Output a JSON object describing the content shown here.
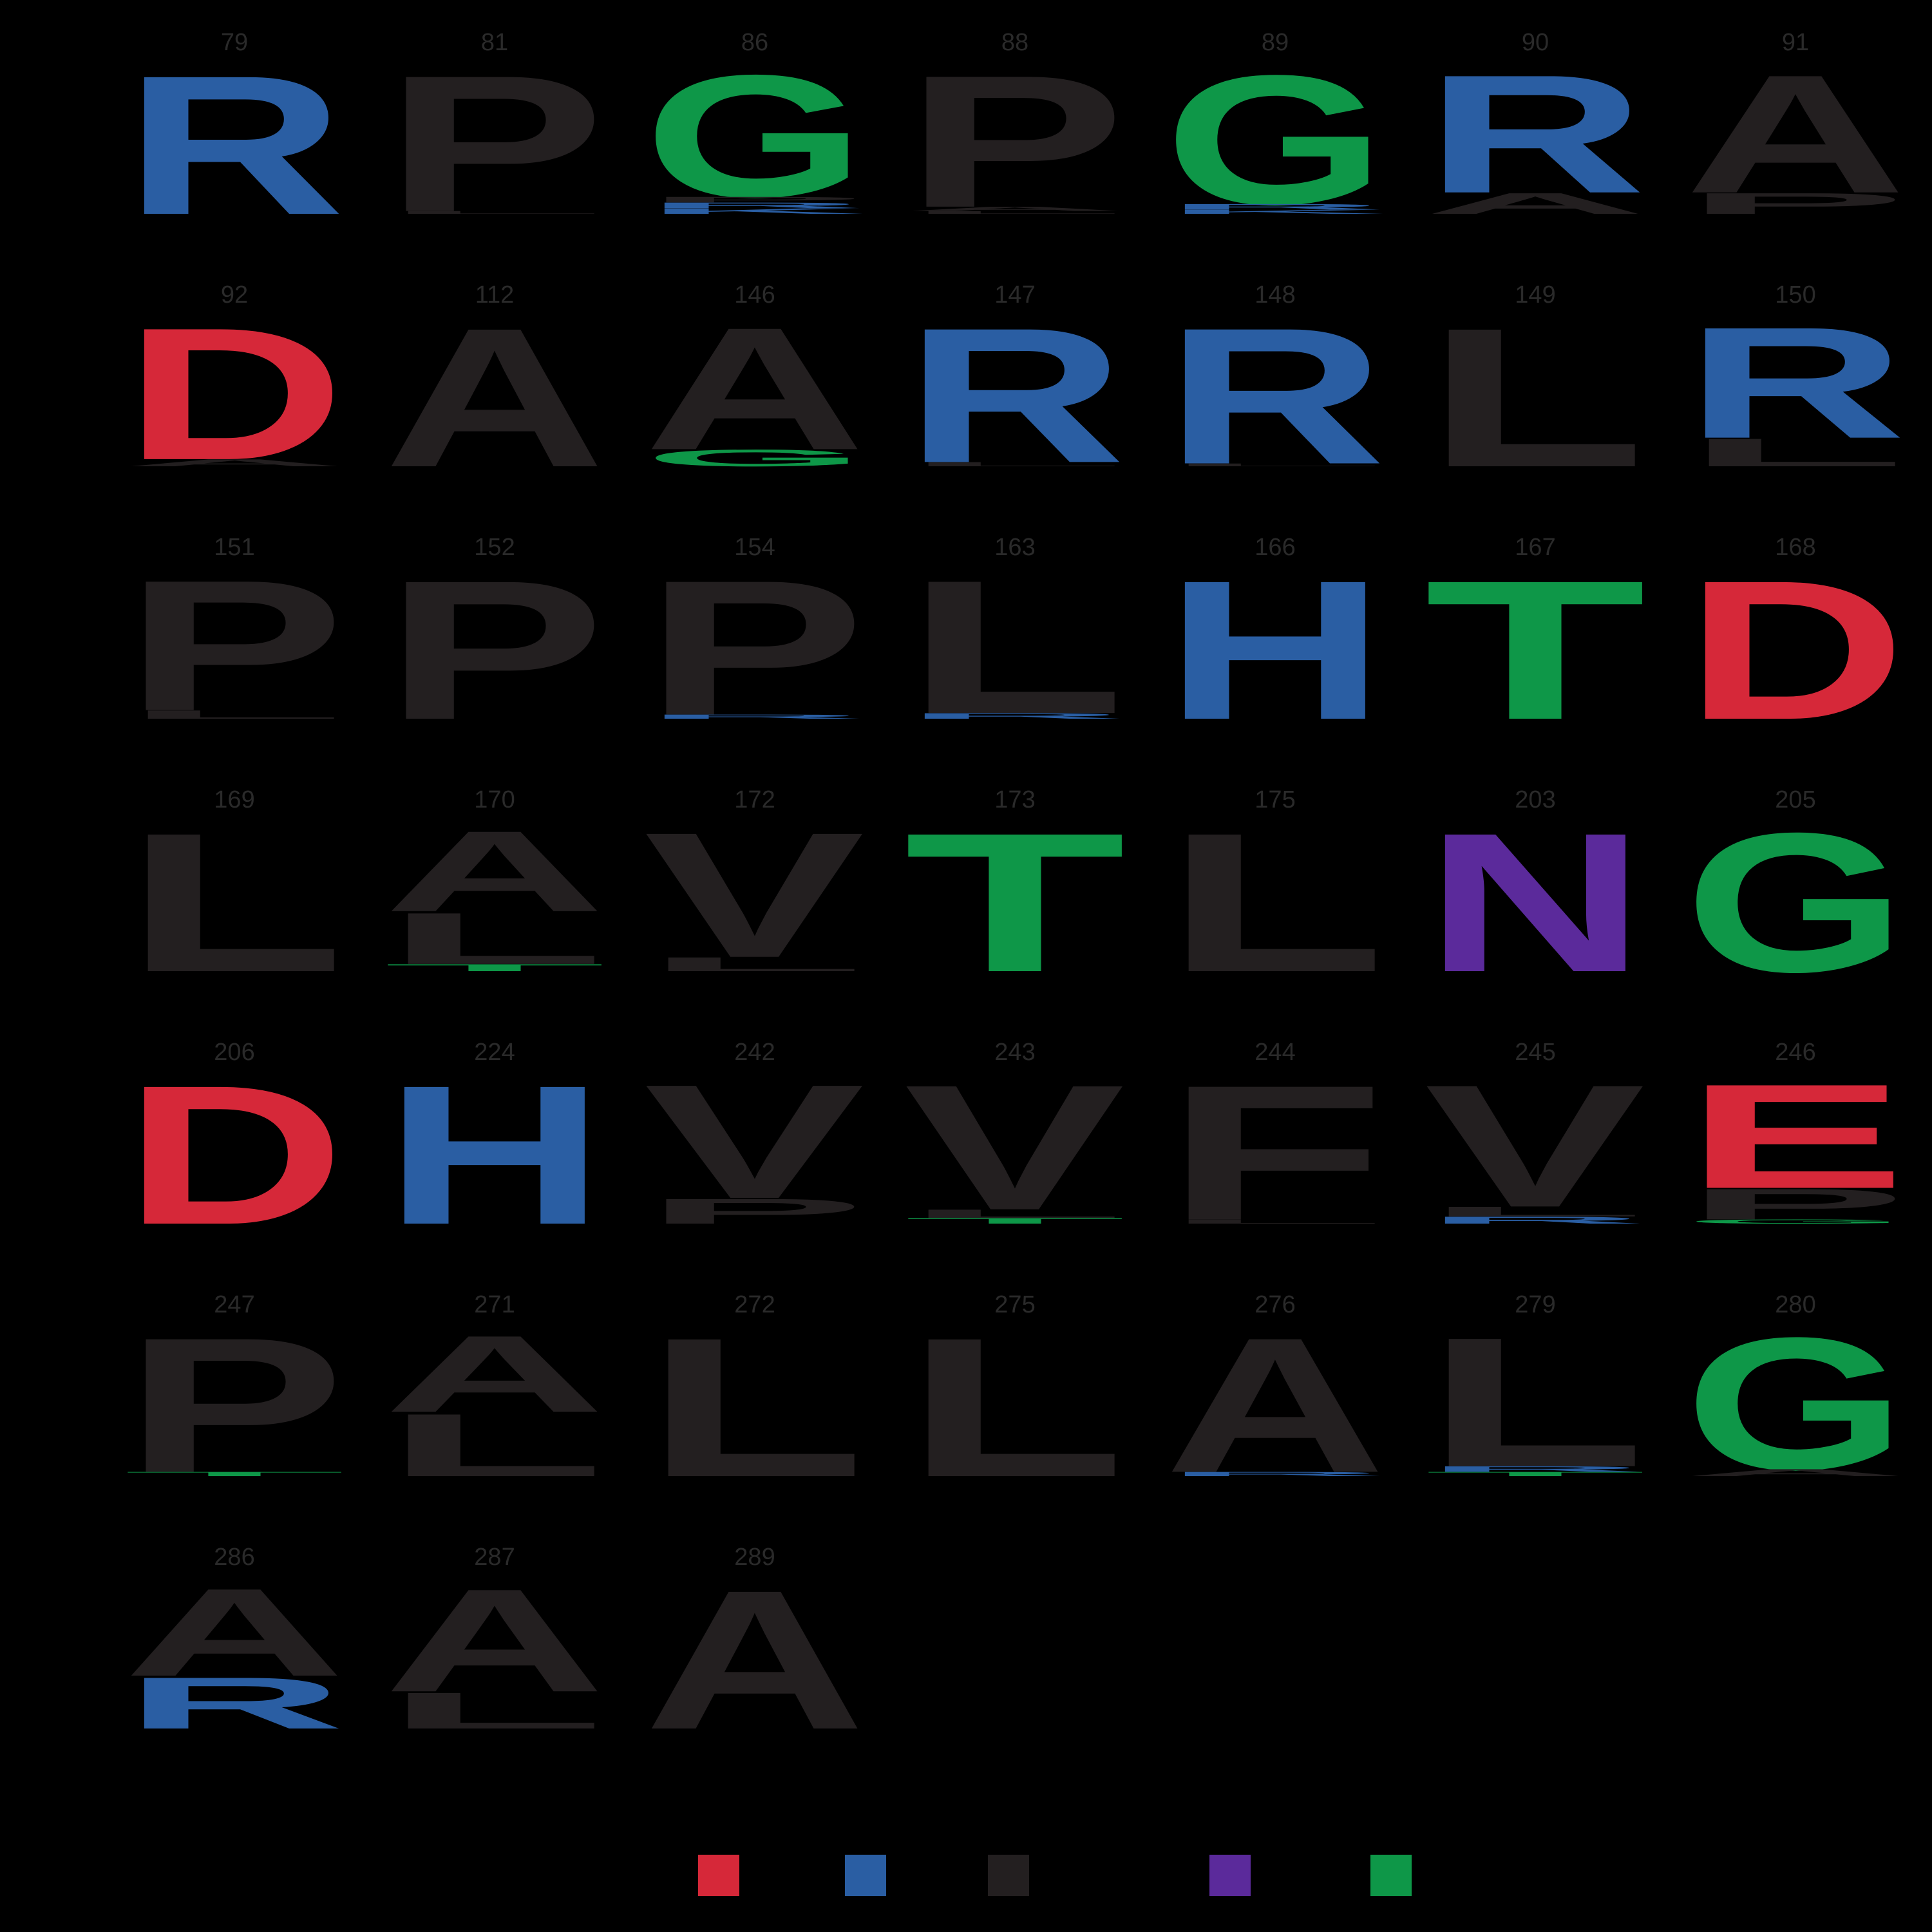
{
  "colors": {
    "background": "#000000",
    "label": "#2a2a2a",
    "red": "#d62839",
    "blue": "#2a5ea3",
    "black": "#231f20",
    "purple": "#5b2a9b",
    "green": "#0e9748"
  },
  "letter_colors": {
    "D": "red",
    "E": "red",
    "R": "blue",
    "H": "blue",
    "K": "blue",
    "N": "purple",
    "Q": "purple",
    "G": "green",
    "T": "green",
    "S": "green",
    "C": "green",
    "Y": "green",
    "A": "black",
    "P": "black",
    "L": "black",
    "V": "black",
    "F": "black",
    "I": "black",
    "M": "black",
    "W": "black"
  },
  "legend": {
    "swatches": [
      {
        "color": "red"
      },
      {
        "color": "blue"
      },
      {
        "color": "black"
      },
      {
        "color": "purple"
      },
      {
        "color": "green"
      }
    ]
  },
  "positions": [
    {
      "label": "79",
      "stack": [
        {
          "aa": "R",
          "h": 1.0
        }
      ]
    },
    {
      "label": "81",
      "stack": [
        {
          "aa": "P",
          "h": 0.98
        },
        {
          "aa": "L",
          "h": 0.02
        }
      ]
    },
    {
      "label": "86",
      "stack": [
        {
          "aa": "G",
          "h": 0.88
        },
        {
          "aa": "P",
          "h": 0.04
        },
        {
          "aa": "R",
          "h": 0.04
        },
        {
          "aa": "K",
          "h": 0.04
        }
      ]
    },
    {
      "label": "88",
      "stack": [
        {
          "aa": "P",
          "h": 0.95
        },
        {
          "aa": "A",
          "h": 0.03
        },
        {
          "aa": "L",
          "h": 0.02
        }
      ]
    },
    {
      "label": "89",
      "stack": [
        {
          "aa": "G",
          "h": 0.93
        },
        {
          "aa": "R",
          "h": 0.04
        },
        {
          "aa": "K",
          "h": 0.03
        }
      ]
    },
    {
      "label": "90",
      "stack": [
        {
          "aa": "R",
          "h": 0.85
        },
        {
          "aa": "A",
          "h": 0.15
        }
      ]
    },
    {
      "label": "91",
      "stack": [
        {
          "aa": "A",
          "h": 0.85
        },
        {
          "aa": "P",
          "h": 0.15
        }
      ]
    },
    {
      "label": "92",
      "stack": [
        {
          "aa": "D",
          "h": 0.95
        },
        {
          "aa": "A",
          "h": 0.05
        }
      ]
    },
    {
      "label": "112",
      "stack": [
        {
          "aa": "A",
          "h": 1.0
        }
      ]
    },
    {
      "label": "146",
      "stack": [
        {
          "aa": "A",
          "h": 0.88
        },
        {
          "aa": "G",
          "h": 0.12
        }
      ]
    },
    {
      "label": "147",
      "stack": [
        {
          "aa": "R",
          "h": 0.97
        },
        {
          "aa": "L",
          "h": 0.03
        }
      ]
    },
    {
      "label": "148",
      "stack": [
        {
          "aa": "R",
          "h": 0.98
        },
        {
          "aa": "L",
          "h": 0.02
        }
      ]
    },
    {
      "label": "149",
      "stack": [
        {
          "aa": "L",
          "h": 1.0
        }
      ]
    },
    {
      "label": "150",
      "stack": [
        {
          "aa": "R",
          "h": 0.8
        },
        {
          "aa": "L",
          "h": 0.2
        }
      ]
    },
    {
      "label": "151",
      "stack": [
        {
          "aa": "P",
          "h": 0.94
        },
        {
          "aa": "L",
          "h": 0.06
        }
      ]
    },
    {
      "label": "152",
      "stack": [
        {
          "aa": "P",
          "h": 1.0
        }
      ]
    },
    {
      "label": "154",
      "stack": [
        {
          "aa": "P",
          "h": 0.97
        },
        {
          "aa": "R",
          "h": 0.03
        }
      ]
    },
    {
      "label": "163",
      "stack": [
        {
          "aa": "L",
          "h": 0.96
        },
        {
          "aa": "R",
          "h": 0.04
        }
      ]
    },
    {
      "label": "166",
      "stack": [
        {
          "aa": "H",
          "h": 1.0
        }
      ]
    },
    {
      "label": "167",
      "stack": [
        {
          "aa": "T",
          "h": 1.0
        }
      ]
    },
    {
      "label": "168",
      "stack": [
        {
          "aa": "D",
          "h": 1.0
        }
      ]
    },
    {
      "label": "169",
      "stack": [
        {
          "aa": "L",
          "h": 1.0
        }
      ]
    },
    {
      "label": "170",
      "stack": [
        {
          "aa": "A",
          "h": 0.58
        },
        {
          "aa": "L",
          "h": 0.37
        },
        {
          "aa": "T",
          "h": 0.05
        }
      ]
    },
    {
      "label": "172",
      "stack": [
        {
          "aa": "V",
          "h": 0.9
        },
        {
          "aa": "L",
          "h": 0.1
        }
      ]
    },
    {
      "label": "173",
      "stack": [
        {
          "aa": "T",
          "h": 1.0
        }
      ]
    },
    {
      "label": "175",
      "stack": [
        {
          "aa": "L",
          "h": 1.0
        }
      ]
    },
    {
      "label": "203",
      "stack": [
        {
          "aa": "N",
          "h": 1.0
        }
      ]
    },
    {
      "label": "205",
      "stack": [
        {
          "aa": "G",
          "h": 1.0
        }
      ]
    },
    {
      "label": "206",
      "stack": [
        {
          "aa": "D",
          "h": 1.0
        }
      ]
    },
    {
      "label": "224",
      "stack": [
        {
          "aa": "H",
          "h": 1.0
        }
      ]
    },
    {
      "label": "242",
      "stack": [
        {
          "aa": "V",
          "h": 0.82
        },
        {
          "aa": "P",
          "h": 0.18
        }
      ]
    },
    {
      "label": "243",
      "stack": [
        {
          "aa": "V",
          "h": 0.9
        },
        {
          "aa": "L",
          "h": 0.06
        },
        {
          "aa": "T",
          "h": 0.04
        }
      ]
    },
    {
      "label": "244",
      "stack": [
        {
          "aa": "F",
          "h": 0.97
        },
        {
          "aa": "L",
          "h": 0.03
        }
      ]
    },
    {
      "label": "245",
      "stack": [
        {
          "aa": "V",
          "h": 0.88
        },
        {
          "aa": "L",
          "h": 0.07
        },
        {
          "aa": "R",
          "h": 0.05
        }
      ]
    },
    {
      "label": "246",
      "stack": [
        {
          "aa": "E",
          "h": 0.75
        },
        {
          "aa": "P",
          "h": 0.22
        },
        {
          "aa": "G",
          "h": 0.03
        }
      ]
    },
    {
      "label": "247",
      "stack": [
        {
          "aa": "P",
          "h": 0.97
        },
        {
          "aa": "T",
          "h": 0.03
        }
      ]
    },
    {
      "label": "271",
      "stack": [
        {
          "aa": "A",
          "h": 0.55
        },
        {
          "aa": "L",
          "h": 0.45
        }
      ]
    },
    {
      "label": "272",
      "stack": [
        {
          "aa": "L",
          "h": 1.0
        }
      ]
    },
    {
      "label": "275",
      "stack": [
        {
          "aa": "L",
          "h": 1.0
        }
      ]
    },
    {
      "label": "276",
      "stack": [
        {
          "aa": "A",
          "h": 0.97
        },
        {
          "aa": "R",
          "h": 0.03
        }
      ]
    },
    {
      "label": "279",
      "stack": [
        {
          "aa": "L",
          "h": 0.93
        },
        {
          "aa": "R",
          "h": 0.04
        },
        {
          "aa": "T",
          "h": 0.03
        }
      ]
    },
    {
      "label": "280",
      "stack": [
        {
          "aa": "G",
          "h": 0.95
        },
        {
          "aa": "A",
          "h": 0.05
        }
      ]
    },
    {
      "label": "286",
      "stack": [
        {
          "aa": "A",
          "h": 0.63
        },
        {
          "aa": "R",
          "h": 0.37
        }
      ]
    },
    {
      "label": "287",
      "stack": [
        {
          "aa": "A",
          "h": 0.74
        },
        {
          "aa": "L",
          "h": 0.26
        }
      ]
    },
    {
      "label": "289",
      "stack": [
        {
          "aa": "A",
          "h": 1.0
        }
      ]
    }
  ]
}
